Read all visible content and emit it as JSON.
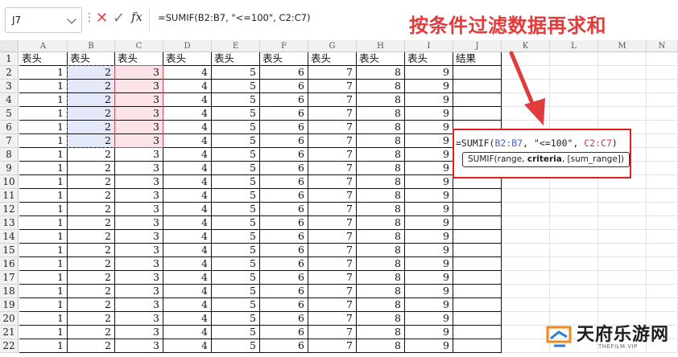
{
  "formula_bar": {
    "name_box": "J7",
    "dots": "⋮",
    "cancel_icon": "✕",
    "enter_icon": "✓",
    "fx_label": "fx",
    "formula": "=SUMIF(B2:B7, \"<=100\", C2:C7)"
  },
  "annotation": {
    "title": "按条件过滤数据再求和",
    "color": "#e23b3b"
  },
  "columns": [
    "A",
    "B",
    "C",
    "D",
    "E",
    "F",
    "G",
    "H",
    "I",
    "J",
    "K",
    "L",
    "M",
    "N"
  ],
  "rows": [
    "1",
    "2",
    "3",
    "4",
    "5",
    "6",
    "7",
    "8",
    "9",
    "10",
    "11",
    "12",
    "13",
    "14",
    "15",
    "16",
    "17",
    "18",
    "19",
    "20",
    "21",
    "22"
  ],
  "header_row": [
    "表头",
    "表头",
    "表头",
    "表头",
    "表头",
    "表头",
    "表头",
    "表头",
    "表头",
    "结果"
  ],
  "data_row": [
    "1",
    "2",
    "3",
    "4",
    "5",
    "6",
    "7",
    "8",
    "9"
  ],
  "editing": {
    "formula_prefix": "=SUMIF(",
    "range1": "B2:B7",
    "criteria": "\"<=100\"",
    "range2": "C2:C7",
    "suffix": ")",
    "tooltip_fn": "SUMIF(range, ",
    "tooltip_bold": "criteria",
    "tooltip_rest": ", [sum_range])"
  },
  "logo": {
    "name": "天府乐游网",
    "sub": "THEFILM.VIP"
  }
}
